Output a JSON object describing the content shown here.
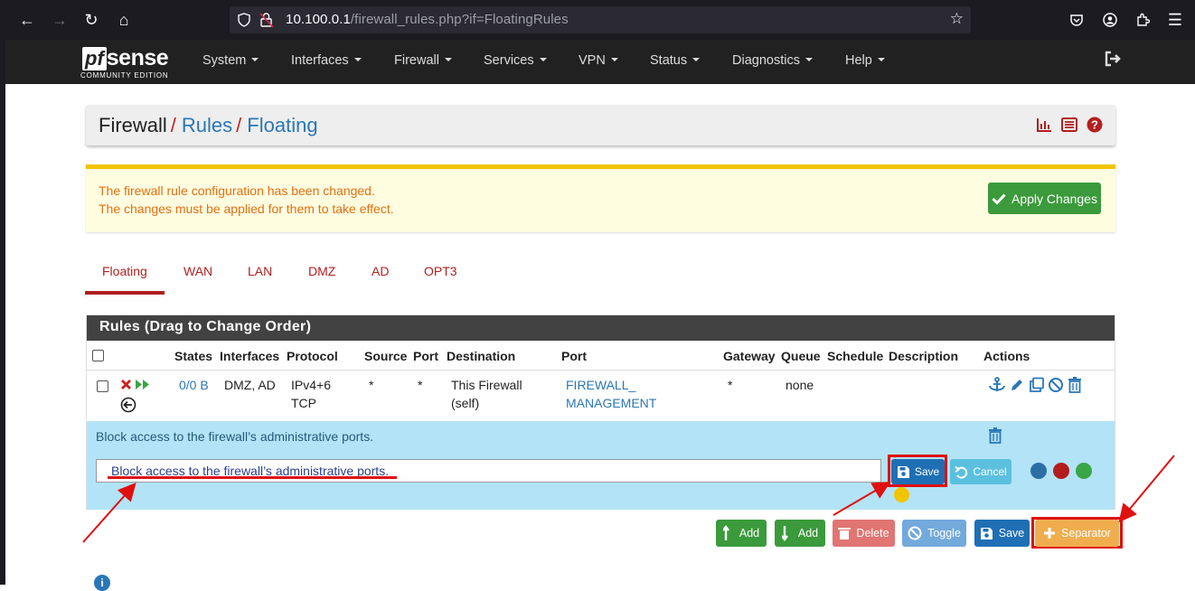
{
  "browser": {
    "url_host": "10.100.0.1",
    "url_path": "/firewall_rules.php?if=FloatingRules"
  },
  "navbar": {
    "logo_main": "pf",
    "logo_sense": "sense",
    "logo_edition": "COMMUNITY EDITION",
    "menu": [
      "System",
      "Interfaces",
      "Firewall",
      "Services",
      "VPN",
      "Status",
      "Diagnostics",
      "Help"
    ]
  },
  "breadcrumb": {
    "root": "Firewall",
    "level2": "Rules",
    "level3": "Floating"
  },
  "alert": {
    "line1": "The firewall rule configuration has been changed.",
    "line2": "The changes must be applied for them to take effect.",
    "apply_label": "Apply Changes"
  },
  "tabs": [
    "Floating",
    "WAN",
    "LAN",
    "DMZ",
    "AD",
    "OPT3"
  ],
  "rules_panel": {
    "title": "Rules (Drag to Change Order)",
    "columns": [
      "States",
      "Interfaces",
      "Protocol",
      "Source",
      "Port",
      "Destination",
      "Port",
      "Gateway",
      "Queue",
      "Schedule",
      "Description",
      "Actions"
    ],
    "row": {
      "states": "0/0 B",
      "interfaces": "DMZ, AD",
      "protocol_1": "IPv4+6",
      "protocol_2": "TCP",
      "source": "*",
      "port": "*",
      "destination_1": "This Firewall",
      "destination_2": "(self)",
      "dest_port_1": "FIREWALL_",
      "dest_port_2": "MANAGEMENT",
      "gateway": "*",
      "queue": "none",
      "schedule": "",
      "description": ""
    },
    "separator": {
      "text": "Block access to the firewall’s administrative ports.",
      "input_value": "Block access to the firewall’s administrative ports.",
      "save_label": "Save",
      "cancel_label": "Cancel",
      "colors": [
        "#2b6fa5",
        "#b31d1d",
        "#3aa547",
        "#f2c400"
      ]
    }
  },
  "bottom_buttons": {
    "add_top": "Add",
    "add_bottom": "Add",
    "delete": "Delete",
    "toggle": "Toggle",
    "save": "Save",
    "separator": "Separator"
  },
  "colors": {
    "brand_red": "#b21f1f",
    "link_blue": "#2a77b6",
    "success_green": "#3b9a3b",
    "annotation_red": "#e01010"
  }
}
